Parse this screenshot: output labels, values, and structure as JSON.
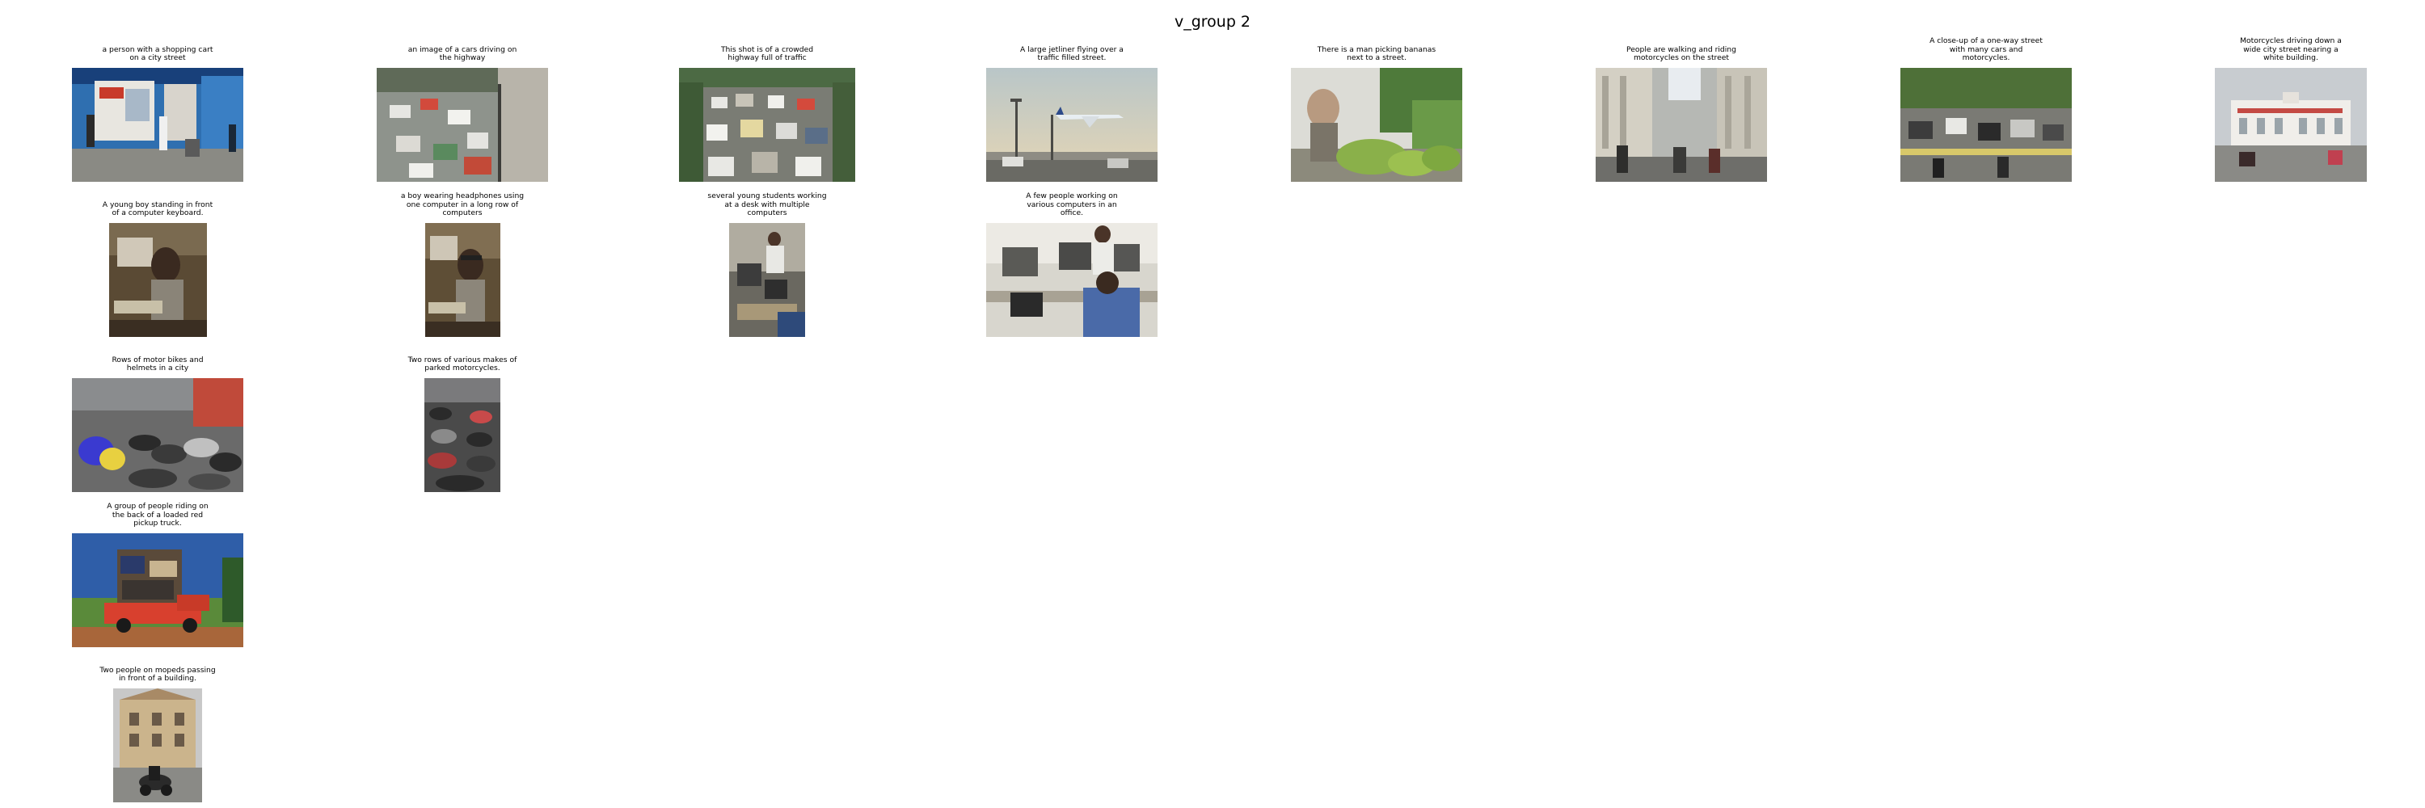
{
  "title": "v_group 2",
  "images": [
    {
      "caption": "a person with a shopping cart\non a city street",
      "scene": "shop-street"
    },
    {
      "caption": "an image of a cars driving on\nthe highway",
      "scene": "highway-cars"
    },
    {
      "caption": "This shot is of a crowded\nhighway full of traffic",
      "scene": "traffic"
    },
    {
      "caption": "A large jetliner flying over a\ntraffic filled street.",
      "scene": "jet"
    },
    {
      "caption": "There is a man picking bananas\nnext to a street.",
      "scene": "bananas"
    },
    {
      "caption": "People are walking and riding\nmotorcycles on the street",
      "scene": "street-walk"
    },
    {
      "caption": "A close-up of a one-way street\nwith many cars and\nmotorcycles.",
      "scene": "oneway"
    },
    {
      "caption": "Motorcycles driving down a\nwide city street nearing a\nwhite building.",
      "scene": "white-building"
    },
    {
      "caption": "A young boy standing in front\nof a computer keyboard.",
      "scene": "boy-keyboard"
    },
    {
      "caption": "a boy wearing headphones using\none computer in a long row of\ncomputers",
      "scene": "boy-headphones"
    },
    {
      "caption": "several young students working\nat a desk with multiple\ncomputers",
      "scene": "students"
    },
    {
      "caption": "A few people working on\nvarious computers in an\noffice.",
      "scene": "office"
    },
    {
      "caption": "Rows of motor bikes and\nhelmets in a city",
      "scene": "bikes-rows"
    },
    {
      "caption": "Two rows of various makes of\nparked motorcycles.",
      "scene": "parked-moto"
    },
    {
      "caption": "A group of people riding on\nthe back of a loaded red\npickup truck.",
      "scene": "pickup"
    },
    {
      "caption": "Two people on mopeds passing\nin front of a building.",
      "scene": "mopeds"
    }
  ]
}
